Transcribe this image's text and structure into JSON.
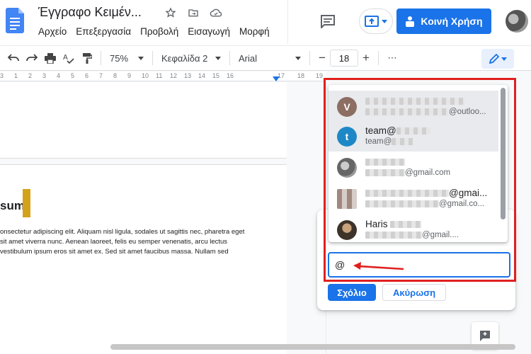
{
  "header": {
    "doc_title": "Έγγραφο Κειμέν...",
    "menu": [
      "Αρχείο",
      "Επεξεργασία",
      "Προβολή",
      "Εισαγωγή",
      "Μορφή"
    ],
    "share_label": "Κοινή Χρήση"
  },
  "toolbar": {
    "zoom": "75%",
    "style": "Κεφαλίδα 2",
    "font": "Arial",
    "font_size": "18",
    "minus": "−",
    "plus": "+",
    "more": "⋯"
  },
  "ruler": {
    "labels": [
      "3",
      "1",
      "2",
      "3",
      "4",
      "5",
      "6",
      "7",
      "8",
      "9",
      "10",
      "11",
      "12",
      "13",
      "14",
      "15",
      "16",
      "17",
      "18",
      "19"
    ]
  },
  "document": {
    "heading": "sum",
    "paragraph_lines": [
      "onsectetur adipiscing elit. Aliquam nisl ligula, sodales ut sagittis  nec, pharetra eget",
      " sit amet viverra nunc. Aenean laoreet, felis eu semper  venenatis, arcu lectus",
      "vestibulum ipsum eros sit amet ex. Sed sit amet faucibus  massa. Nullam sed"
    ]
  },
  "mentions": [
    {
      "initial": "V",
      "name": "",
      "email": "@outloo...",
      "color": "#8d6e63"
    },
    {
      "initial": "t",
      "name": "team@",
      "email": "team@",
      "color": "#1e88c6"
    },
    {
      "initial": "",
      "name": "",
      "email": "@gmail.com",
      "color": "#777777"
    },
    {
      "initial": "",
      "name": "@gmai...",
      "email": "@gmail.co...",
      "color": "#a1887f"
    },
    {
      "initial": "",
      "name": "Haris",
      "email": "@gmail....",
      "color": "#4a3f35"
    }
  ],
  "comment": {
    "input_value": "@",
    "submit_label": "Σχόλιο",
    "cancel_label": "Ακύρωση"
  },
  "colors": {
    "accent": "#1a73e8",
    "highlight_frame": "#e0201f",
    "heading_bar": "#d4a21a"
  }
}
